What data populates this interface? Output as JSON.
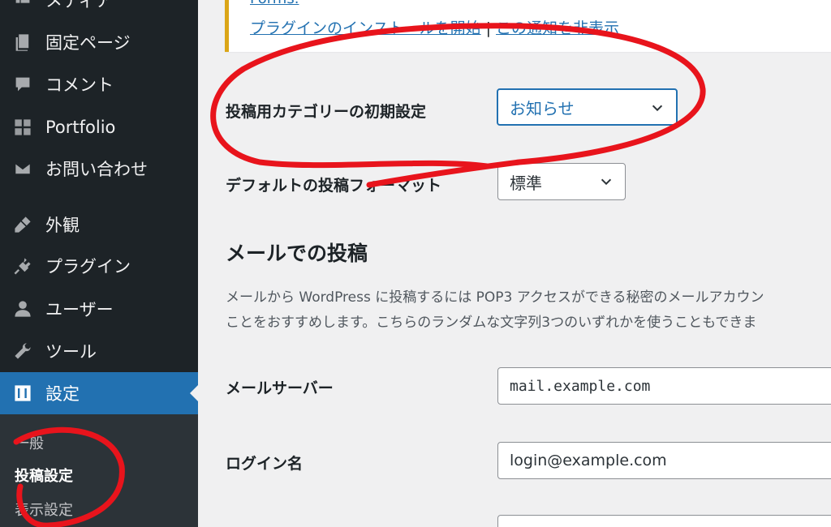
{
  "sidebar": {
    "items": [
      {
        "label": "メディア",
        "icon": "media-icon"
      },
      {
        "label": "固定ページ",
        "icon": "pages-icon"
      },
      {
        "label": "コメント",
        "icon": "comments-icon"
      },
      {
        "label": "Portfolio",
        "icon": "portfolio-icon"
      },
      {
        "label": "お問い合わせ",
        "icon": "mail-icon"
      },
      {
        "label": "外観",
        "icon": "appearance-icon"
      },
      {
        "label": "プラグイン",
        "icon": "plugins-icon"
      },
      {
        "label": "ユーザー",
        "icon": "users-icon"
      },
      {
        "label": "ツール",
        "icon": "tools-icon"
      },
      {
        "label": "設定",
        "icon": "settings-icon"
      }
    ],
    "submenu": [
      {
        "label": "一般"
      },
      {
        "label": "投稿設定"
      },
      {
        "label": "表示設定"
      }
    ]
  },
  "notice": {
    "top_text": "Forms.",
    "link_install": "プラグインのインストールを開始",
    "separator": "|",
    "link_dismiss": "この通知を非表示"
  },
  "writing": {
    "category_label": "投稿用カテゴリーの初期設定",
    "category_value": "お知らせ",
    "format_label": "デフォルトの投稿フォーマット",
    "format_value": "標準"
  },
  "post_via_email": {
    "title": "メールでの投稿",
    "desc_line1": "メールから WordPress に投稿するには POP3 アクセスができる秘密のメールアカウン",
    "desc_line2": "ことをおすすめします。こちらのランダムな文字列3つのいずれかを使うこともできま",
    "server_label": "メールサーバー",
    "server_value": "mail.example.com",
    "login_label": "ログイン名",
    "login_value": "login@example.com"
  },
  "colors": {
    "sidebar_bg": "#1d2327",
    "active_bg": "#2271b1",
    "annotation": "#e8141c",
    "notice_border": "#dba617"
  }
}
